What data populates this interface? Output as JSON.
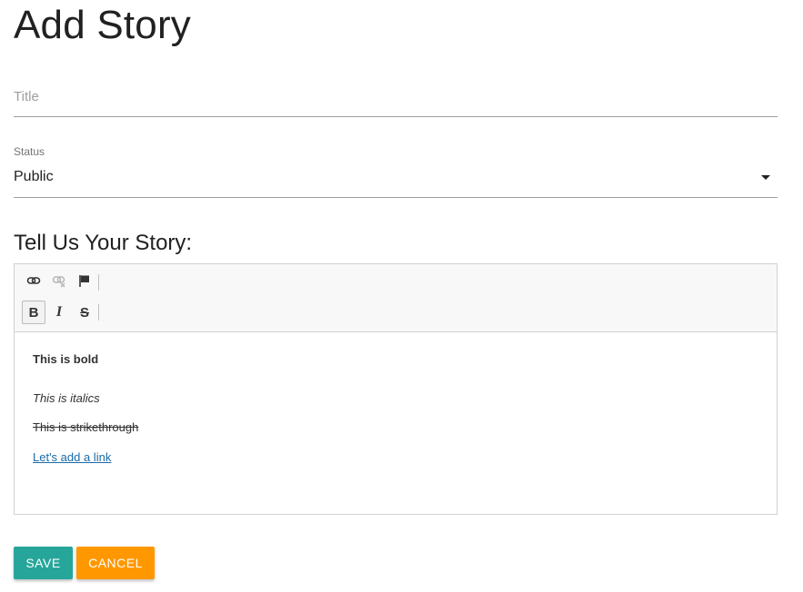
{
  "page": {
    "title": "Add Story"
  },
  "form": {
    "title_field": {
      "placeholder": "Title",
      "value": ""
    },
    "status": {
      "label": "Status",
      "selected": "Public"
    },
    "story_heading": "Tell Us Your Story:"
  },
  "editor": {
    "toolbar": {
      "row1": [
        "link-icon",
        "unlink-icon",
        "anchor-flag-icon"
      ],
      "row2": [
        {
          "icon": "bold-icon",
          "glyph": "B",
          "active": true
        },
        {
          "icon": "italic-icon",
          "glyph": "I",
          "active": false
        },
        {
          "icon": "strikethrough-icon",
          "glyph": "S",
          "active": false
        }
      ]
    },
    "content": {
      "bold_text": "This is bold",
      "italic_text": "This is italics",
      "strike_text": "This is strikethrough",
      "link_text": "Let's add a link"
    }
  },
  "buttons": {
    "save_label": "Save",
    "cancel_label": "Cancel"
  },
  "colors": {
    "save": "#26a69a",
    "cancel": "#ff9800",
    "link": "#1a6aa8"
  }
}
